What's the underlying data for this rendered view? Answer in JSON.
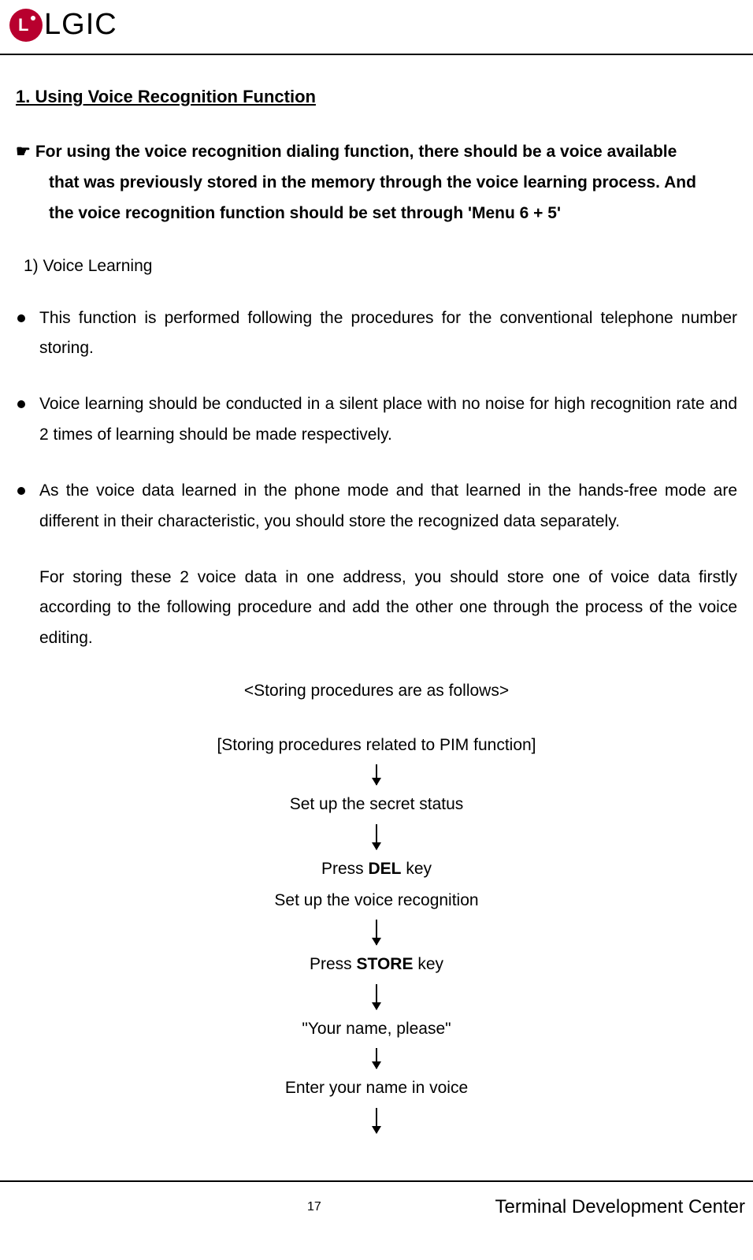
{
  "header": {
    "logo_text": "LGIC"
  },
  "section": {
    "heading": "1. Using Voice Recognition Function",
    "note_pointer": "☛",
    "note_line1": "For using the voice recognition dialing function, there should be a voice available",
    "note_line2": "that was previously stored in the memory through the voice learning process. And",
    "note_line3": "the voice recognition function should be set through 'Menu 6 + 5'",
    "subsection": "1) Voice Learning",
    "bullets": [
      "This function is performed following the procedures for the conventional telephone number storing.",
      "Voice learning should be conducted in a silent place with no noise for high recognition rate and 2 times of learning should be made respectively.",
      "As the voice data learned in the phone mode and that learned in the hands-free mode are different in their characteristic, you should store the recognized data separately."
    ],
    "continuation": "For storing these 2 voice data in one address, you should store one of voice data firstly according to the following procedure and add the other one through the process of the voice editing.",
    "procedures_title": "<Storing procedures are as follows>",
    "steps": [
      "[Storing procedures related to PIM function]",
      "Set up the secret status",
      "Press DEL key",
      "Set up the voice recognition",
      "Press STORE key",
      "\"Your name, please\"",
      "Enter your name in voice"
    ],
    "bold_del": "DEL",
    "bold_store": "STORE",
    "step_press": "Press ",
    "step_key": " key"
  },
  "footer": {
    "page": "17",
    "center": "Terminal Development Center"
  }
}
